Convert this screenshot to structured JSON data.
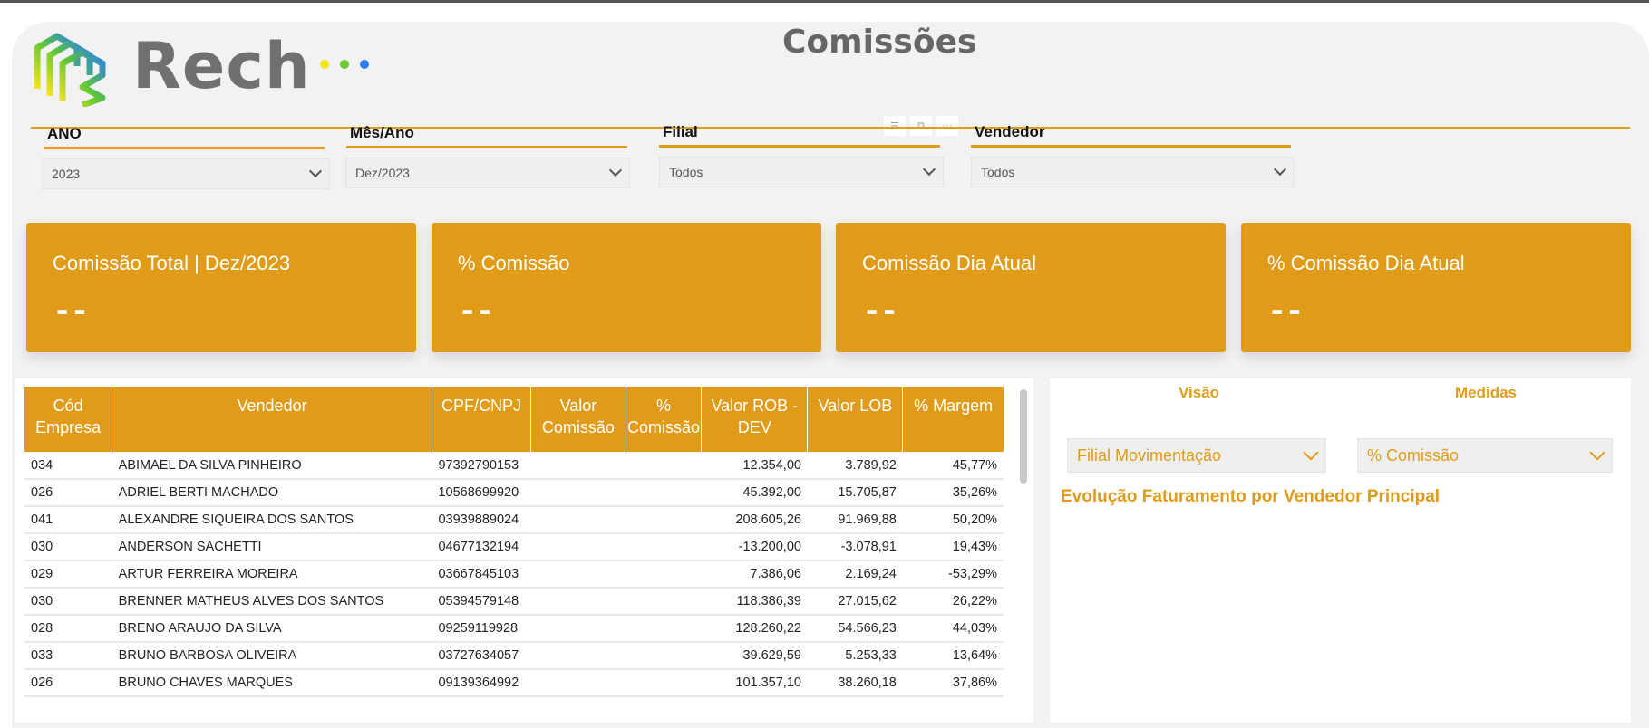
{
  "brand": {
    "name": "Rech",
    "dot_colors": [
      "#f4e51a",
      "#6ccb2e",
      "#2c7ef0"
    ]
  },
  "page_title": "Comissões",
  "filters": [
    {
      "label": "ANO",
      "value": "2023"
    },
    {
      "label": "Mês/Ano",
      "value": "Dez/2023"
    },
    {
      "label": "Filial",
      "value": "Todos"
    },
    {
      "label": "Vendedor",
      "value": "Todos"
    }
  ],
  "cards": [
    {
      "title": "Comissão Total | Dez/2023",
      "value": "--"
    },
    {
      "title": "% Comissão",
      "value": "--"
    },
    {
      "title": "Comissão Dia Atual",
      "value": "--"
    },
    {
      "title": "% Comissão Dia Atual",
      "value": "--"
    }
  ],
  "table": {
    "headers": [
      "Cód Empresa",
      "Vendedor",
      "CPF/CNPJ",
      "Valor Comissão",
      "% Comissão",
      "Valor ROB - DEV",
      "Valor LOB",
      "% Margem"
    ],
    "rows": [
      [
        "034",
        "ABIMAEL DA SILVA PINHEIRO",
        "97392790153",
        "",
        "",
        "12.354,00",
        "3.789,92",
        "45,77%"
      ],
      [
        "026",
        "ADRIEL BERTI MACHADO",
        "10568699920",
        "",
        "",
        "45.392,00",
        "15.705,87",
        "35,26%"
      ],
      [
        "041",
        "ALEXANDRE SIQUEIRA DOS SANTOS",
        "03939889024",
        "",
        "",
        "208.605,26",
        "91.969,88",
        "50,20%"
      ],
      [
        "030",
        "ANDERSON SACHETTI",
        "04677132194",
        "",
        "",
        "-13.200,00",
        "-3.078,91",
        "19,43%"
      ],
      [
        "029",
        "ARTUR FERREIRA MOREIRA",
        "03667845103",
        "",
        "",
        "7.386,06",
        "2.169,24",
        "-53,29%"
      ],
      [
        "030",
        "BRENNER MATHEUS ALVES DOS SANTOS",
        "05394579148",
        "",
        "",
        "118.386,39",
        "27.015,62",
        "26,22%"
      ],
      [
        "028",
        "BRENO ARAUJO DA SILVA",
        "09259119928",
        "",
        "",
        "128.260,22",
        "54.566,23",
        "44,03%"
      ],
      [
        "033",
        "BRUNO BARBOSA OLIVEIRA",
        "03727634057",
        "",
        "",
        "39.629,59",
        "5.253,33",
        "13,64%"
      ],
      [
        "026",
        "BRUNO CHAVES MARQUES",
        "09139364992",
        "",
        "",
        "101.357,10",
        "38.260,18",
        "37,86%"
      ]
    ]
  },
  "right_panel": {
    "visao_label": "Visão",
    "visao_value": "Filial Movimentação",
    "medidas_label": "Medidas",
    "medidas_value": "% Comissão",
    "chart_title": "Evolução Faturamento por Vendedor Principal"
  },
  "toolbar_icons": [
    "filter-icon",
    "focus-mode-icon",
    "more-options-icon"
  ],
  "accent_color": "#e09c19"
}
